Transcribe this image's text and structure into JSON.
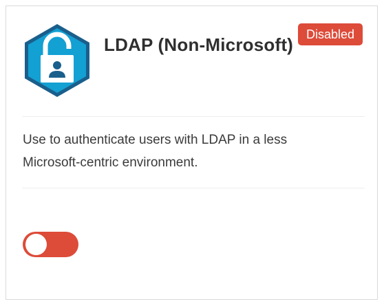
{
  "card": {
    "title": "LDAP (Non-Microsoft)",
    "status_badge": "Disabled",
    "description": "Use to authenticate users with LDAP in a less Microsoft-centric environment.",
    "logo_icon": "lock-user-hexagon-icon",
    "toggle": {
      "state": "off",
      "on": false
    }
  },
  "colors": {
    "logo_outer": "#1a5f8c",
    "logo_inner": "#13a0d3",
    "badge": "#dd4b39",
    "toggle_track": "#dd4b39",
    "title_text": "#2f2f2f",
    "body_text": "#3a3a3a"
  }
}
